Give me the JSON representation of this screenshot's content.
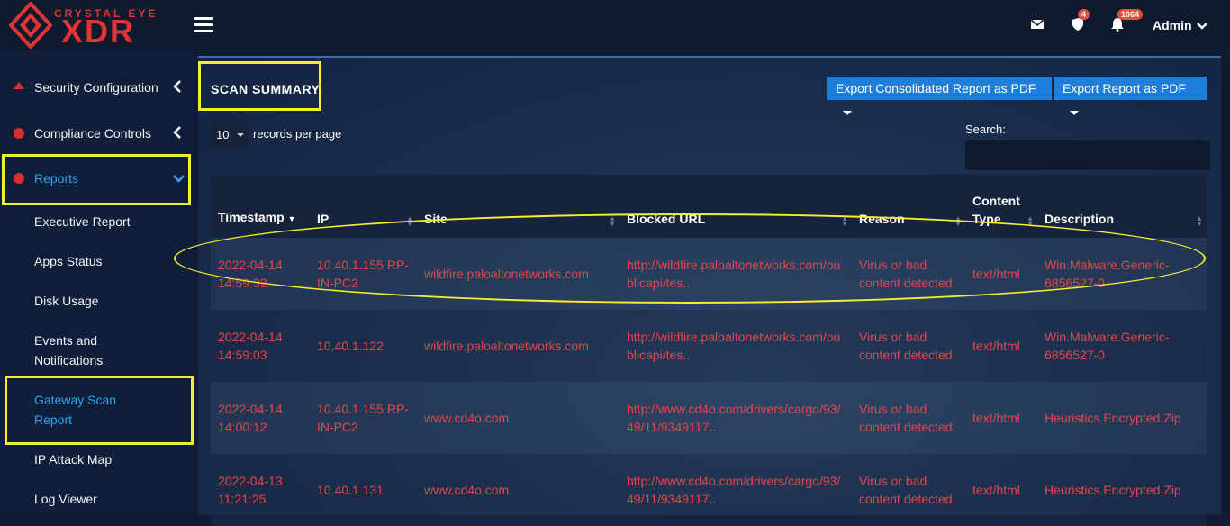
{
  "brand": {
    "top": "CRYSTAL EYE",
    "bottom": "XDR"
  },
  "topbar": {
    "mail_icon": "envelope-icon",
    "shield_badge": "4",
    "bell_badge": "1064",
    "user": "Admin"
  },
  "sidebar": {
    "items": [
      {
        "label": "Security Configuration"
      },
      {
        "label": "Compliance Controls"
      },
      {
        "label": "Reports"
      }
    ],
    "sub_items": [
      {
        "label": "Executive Report"
      },
      {
        "label": "Apps Status"
      },
      {
        "label": "Disk Usage"
      },
      {
        "label": "Events and Notifications"
      },
      {
        "label": "Gateway Scan Report"
      },
      {
        "label": "IP Attack Map"
      },
      {
        "label": "Log Viewer"
      }
    ]
  },
  "main": {
    "title": "SCAN SUMMARY",
    "export_consolidated": "Export Consolidated Report as PDF",
    "export_report": "Export Report as PDF",
    "length_value": "10",
    "length_label": "records per page",
    "search_label": "Search:",
    "columns": [
      "Timestamp",
      "IP",
      "Site",
      "Blocked URL",
      "Reason",
      "Content Type",
      "Description"
    ],
    "rows": [
      {
        "timestamp": "2022-04-14 14:59:32",
        "ip": "10.40.1.155 RP-IN-PC2",
        "site": "wildfire.paloaltonetworks.com",
        "url": "http://wildfire.paloaltonetworks.com/publicapi/tes..",
        "reason": "Virus or bad content detected.",
        "content_type": "text/html",
        "description": "Win.Malware.Generic-6856527-0"
      },
      {
        "timestamp": "2022-04-14 14:59:03",
        "ip": "10.40.1.122",
        "site": "wildfire.paloaltonetworks.com",
        "url": "http://wildfire.paloaltonetworks.com/publicapi/tes..",
        "reason": "Virus or bad content detected.",
        "content_type": "text/html",
        "description": "Win.Malware.Generic-6856527-0"
      },
      {
        "timestamp": "2022-04-14 14:00:12",
        "ip": "10.40.1.155 RP-IN-PC2",
        "site": "www.cd4o.com",
        "url": "http://www.cd4o.com/drivers/cargo/93/49/11/9349117..",
        "reason": "Virus or bad content detected.",
        "content_type": "text/html",
        "description": "Heuristics.Encrypted.Zip"
      },
      {
        "timestamp": "2022-04-13 11:21:25",
        "ip": "10.40.1.131",
        "site": "www.cd4o.com",
        "url": "http://www.cd4o.com/drivers/cargo/93/49/11/9349117..",
        "reason": "Virus or bad content detected.",
        "content_type": "text/html",
        "description": "Heuristics.Encrypted.Zip"
      }
    ]
  },
  "colors": {
    "accent": "#1f7fd8",
    "row_text": "#e04848",
    "highlight": "#f4ee2e",
    "brand": "#e03434"
  }
}
